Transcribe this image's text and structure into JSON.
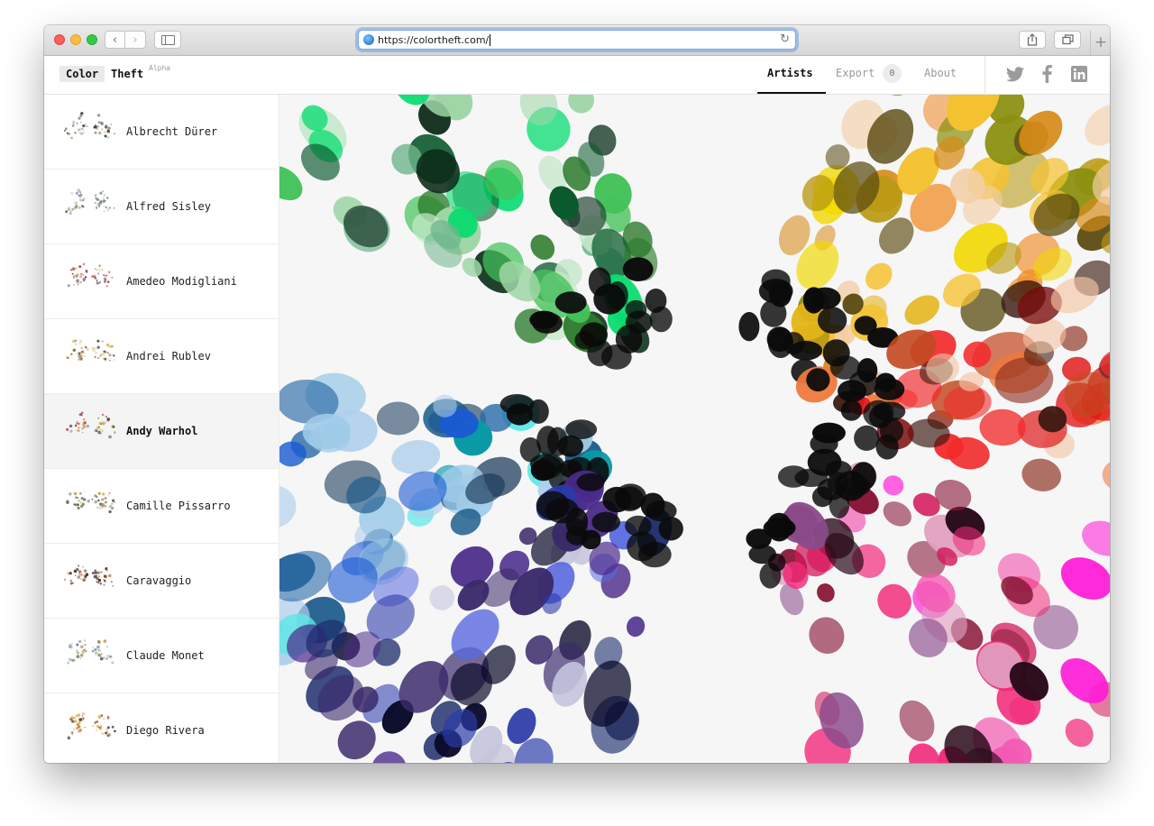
{
  "browser": {
    "url": "https://colortheft.com/",
    "icons": {
      "back": "chevron-left-icon",
      "forward": "chevron-right-icon",
      "sidebar": "sidebar-icon",
      "reload": "reload-icon",
      "share": "share-icon",
      "tabs": "tabs-overview-icon",
      "new_tab": "plus-icon"
    }
  },
  "header": {
    "logo_word1": "Color",
    "logo_word2": "Theft",
    "logo_tag": "Alpha",
    "nav": {
      "artists": "Artists",
      "export": "Export",
      "export_count": "0",
      "about": "About"
    },
    "social": [
      "twitter-icon",
      "facebook-icon",
      "linkedin-icon"
    ]
  },
  "sidebar": {
    "selected": "Andy Warhol",
    "artists": [
      {
        "name": "Albrecht Dürer",
        "palette": [
          "#3a3a3a",
          "#8a8a8a",
          "#bcbcbc",
          "#6e5d3f"
        ]
      },
      {
        "name": "Alfred Sisley",
        "palette": [
          "#4a5a6a",
          "#8a9aaa",
          "#6e7a5a",
          "#c2b890"
        ]
      },
      {
        "name": "Amedeo Modigliani",
        "palette": [
          "#3a2a2a",
          "#a83a2a",
          "#d9a04a",
          "#6a4a8a"
        ]
      },
      {
        "name": "Andrei Rublev",
        "palette": [
          "#4a3a2a",
          "#c89a3a",
          "#8a6a3a",
          "#e2c270"
        ]
      },
      {
        "name": "Andy Warhol",
        "palette": [
          "#c23a4a",
          "#2a6a9a",
          "#e2c23a",
          "#3a3a3a"
        ]
      },
      {
        "name": "Camille Pissarro",
        "palette": [
          "#5a6a4a",
          "#9a8a5a",
          "#c2a24a",
          "#3a4a3a"
        ]
      },
      {
        "name": "Caravaggio",
        "palette": [
          "#2a1a12",
          "#8a4a2a",
          "#c27a3a",
          "#5a2a1a"
        ]
      },
      {
        "name": "Claude Monet",
        "palette": [
          "#4a6a8a",
          "#8aa2b2",
          "#7a8a4a",
          "#c2a25a"
        ]
      },
      {
        "name": "Diego Rivera",
        "palette": [
          "#3a2a1a",
          "#c27a2a",
          "#7a4a2a",
          "#e2a23a"
        ]
      }
    ]
  },
  "viz": {
    "title": "color-burst-visualization",
    "clusters": [
      {
        "name": "greens",
        "colors": [
          "#c8e8cc",
          "#9fd6a6",
          "#44c25a",
          "#2a7a2a",
          "#0b5a2e",
          "#0c2a18",
          "#08dc70",
          "#6fb58c",
          "#1b3d2a"
        ]
      },
      {
        "name": "olives-golds",
        "colors": [
          "#f1d800",
          "#e3b417",
          "#8a8f0f",
          "#b99a14",
          "#f4c230",
          "#d68b17",
          "#f08c25",
          "#f3cfa6",
          "#5a4a10"
        ]
      },
      {
        "name": "oranges-reds",
        "colors": [
          "#ee7a3c",
          "#c24a22",
          "#8a2a1a",
          "#e01a1a",
          "#7a0a0a",
          "#f22a2a",
          "#f4c4a4",
          "#3a1a10"
        ]
      },
      {
        "name": "teals-blues",
        "colors": [
          "#5ee8e8",
          "#0a9aa6",
          "#1a5a8a",
          "#2a6aa8",
          "#9fcbe8",
          "#1a3a5a",
          "#1a5ad2",
          "#b0d0ec"
        ]
      },
      {
        "name": "navies-indigos",
        "colors": [
          "#0a0a2a",
          "#1a2a6a",
          "#2a3aa8",
          "#5a6ade",
          "#4a2a8a",
          "#3a2a6a",
          "#c4c4dc"
        ]
      },
      {
        "name": "magentas-pinks",
        "colors": [
          "#2a0a1a",
          "#8a1a3a",
          "#d21a5a",
          "#f22a7a",
          "#f25ab2",
          "#ff1ad6",
          "#e0a0c0",
          "#8a4a8a"
        ]
      }
    ]
  }
}
